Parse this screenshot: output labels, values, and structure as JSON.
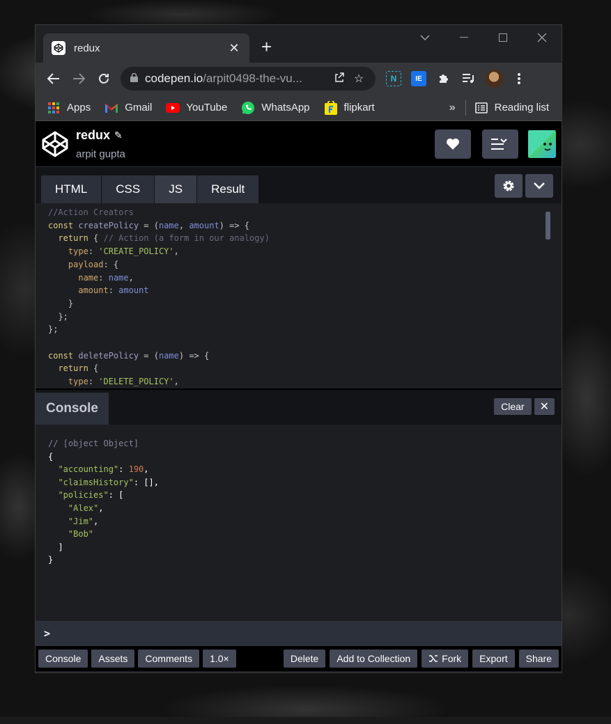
{
  "browser": {
    "tab_title": "redux",
    "new_tab_symbol": "+",
    "url_host": "codepen.io",
    "url_path": "/arpit0498-the-vu...",
    "bookmarks": [
      {
        "label": "Apps",
        "icon": "apps-grid-icon"
      },
      {
        "label": "Gmail",
        "icon": "gmail-icon"
      },
      {
        "label": "YouTube",
        "icon": "youtube-icon"
      },
      {
        "label": "WhatsApp",
        "icon": "whatsapp-icon"
      },
      {
        "label": "flipkart",
        "icon": "flipkart-icon"
      }
    ],
    "overflow_label": "»",
    "reading_list": "Reading list"
  },
  "pen": {
    "title": "redux",
    "author": "arpit gupta"
  },
  "editor": {
    "tabs": [
      "HTML",
      "CSS",
      "JS",
      "Result"
    ],
    "active_tab": "JS"
  },
  "console": {
    "tab_label": "Console",
    "clear_label": "Clear",
    "close_symbol": "✕",
    "prompt": ">"
  },
  "footer": {
    "left": [
      "Console",
      "Assets",
      "Comments",
      "1.0×"
    ],
    "delete": "Delete",
    "add_to_collection": "Add to Collection",
    "fork": "Fork",
    "export": "Export",
    "share": "Share"
  },
  "colors": {
    "codepen_button": "#444857",
    "editor_bg": "#1d1e22",
    "string": "#a8c562",
    "keyword": "#ddca7e",
    "number": "#d27b53"
  }
}
